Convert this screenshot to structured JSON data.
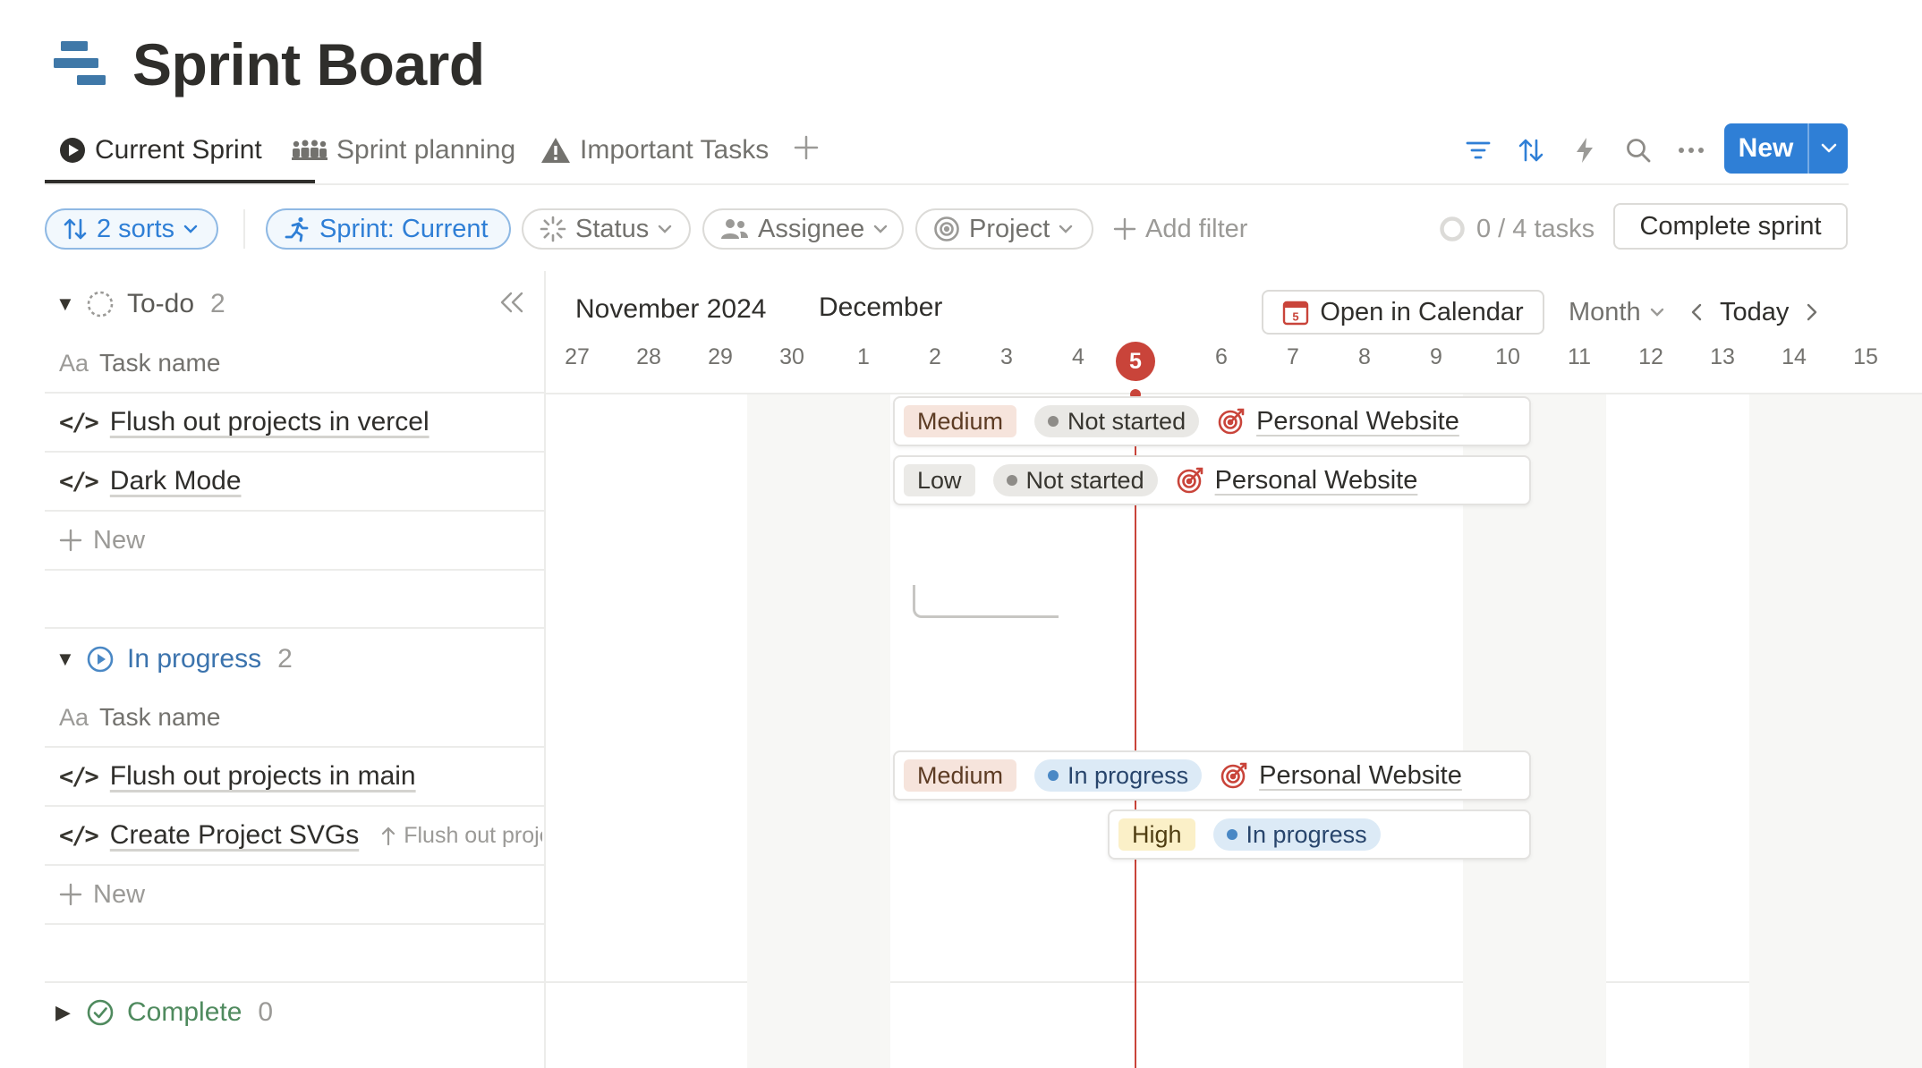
{
  "page": {
    "title": "Sprint Board"
  },
  "tabs": [
    {
      "label": "Current Sprint",
      "active": true
    },
    {
      "label": "Sprint planning"
    },
    {
      "label": "Important Tasks"
    }
  ],
  "toolbar": {
    "new_label": "New",
    "accent": "#2f7fd6"
  },
  "filters": {
    "sorts": "2 sorts",
    "sprint": "Sprint: Current",
    "status": "Status",
    "assignee": "Assignee",
    "project": "Project",
    "add_filter": "Add filter",
    "task_count": "0 / 4 tasks",
    "complete_sprint": "Complete sprint"
  },
  "columns": {
    "aa": "Aa",
    "task_name": "Task name"
  },
  "groups": [
    {
      "name": "To-do",
      "count": "2",
      "tasks": [
        {
          "name": "Flush out projects in vercel",
          "priority": "Medium",
          "status": "Not started",
          "project": "Personal Website"
        },
        {
          "name": "Dark Mode",
          "priority": "Low",
          "status": "Not started",
          "project": "Personal Website"
        }
      ],
      "new_label": "New"
    },
    {
      "name": "In progress",
      "count": "2",
      "tasks": [
        {
          "name": "Flush out projects in main",
          "priority": "Medium",
          "status": "In progress",
          "project": "Personal Website"
        },
        {
          "name": "Create Project SVGs",
          "parent": "Flush out proje",
          "priority": "High",
          "status": "In progress"
        }
      ],
      "new_label": "New"
    },
    {
      "name": "Complete",
      "count": "0"
    }
  ],
  "calendar": {
    "months": [
      "November 2024",
      "December"
    ],
    "days": [
      "27",
      "28",
      "29",
      "30",
      "1",
      "2",
      "3",
      "4",
      "5",
      "6",
      "7",
      "8",
      "9",
      "10",
      "11",
      "12",
      "13",
      "14",
      "15"
    ],
    "today": "5",
    "open_in_calendar": "Open in Calendar",
    "cal_icon_day": "5",
    "scale": "Month",
    "today_label": "Today"
  }
}
